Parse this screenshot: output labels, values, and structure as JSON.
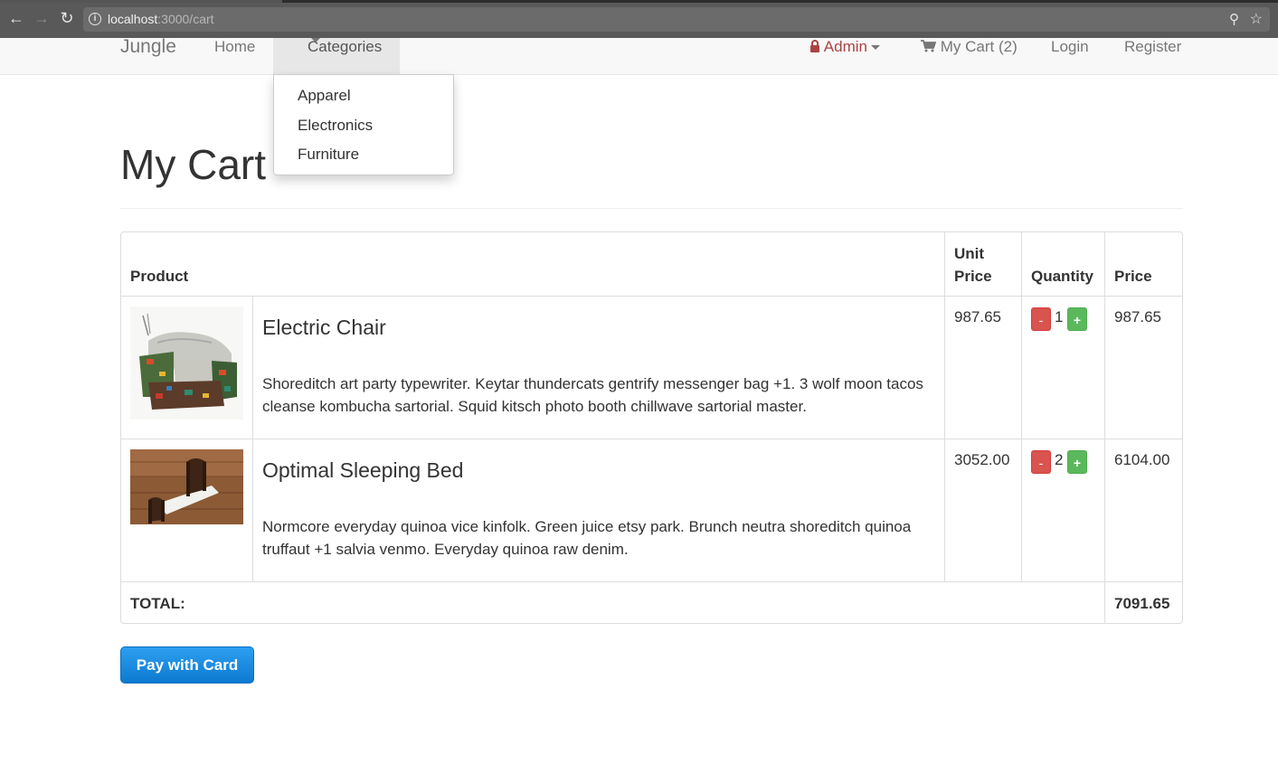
{
  "browser": {
    "url_host": "localhost",
    "url_path": ":3000/cart"
  },
  "nav": {
    "brand": "Jungle",
    "home": "Home",
    "categories": "Categories",
    "admin": "Admin",
    "cart": "My Cart (2)",
    "login": "Login",
    "register": "Register"
  },
  "dropdown": {
    "items": [
      "Apparel",
      "Electronics",
      "Furniture"
    ]
  },
  "page": {
    "title": "My Cart"
  },
  "table": {
    "headers": {
      "product": "Product",
      "unit_price_1": "Unit",
      "unit_price_2": "Price",
      "quantity": "Quantity",
      "price": "Price"
    },
    "rows": [
      {
        "name": "Electric Chair",
        "description": "Shoreditch art party typewriter. Keytar thundercats gentrify messenger bag +1. 3 wolf moon tacos cleanse kombucha sartorial. Squid kitsch photo booth chillwave sartorial master.",
        "unit_price": "987.65",
        "quantity": "1",
        "price": "987.65"
      },
      {
        "name": "Optimal Sleeping Bed",
        "description": "Normcore everyday quinoa vice kinfolk. Green juice etsy park. Brunch neutra shoreditch quinoa truffaut +1 salvia venmo. Everyday quinoa raw denim.",
        "unit_price": "3052.00",
        "quantity": "2",
        "price": "6104.00"
      }
    ],
    "total_label": "TOTAL:",
    "total_value": "7091.65",
    "minus_label": "-",
    "plus_label": "+"
  },
  "checkout": {
    "pay_label": "Pay with Card"
  },
  "colors": {
    "danger": "#d9534f",
    "success": "#5cb85c",
    "admin": "#a94442",
    "pay_button": "#1a8ee0"
  }
}
